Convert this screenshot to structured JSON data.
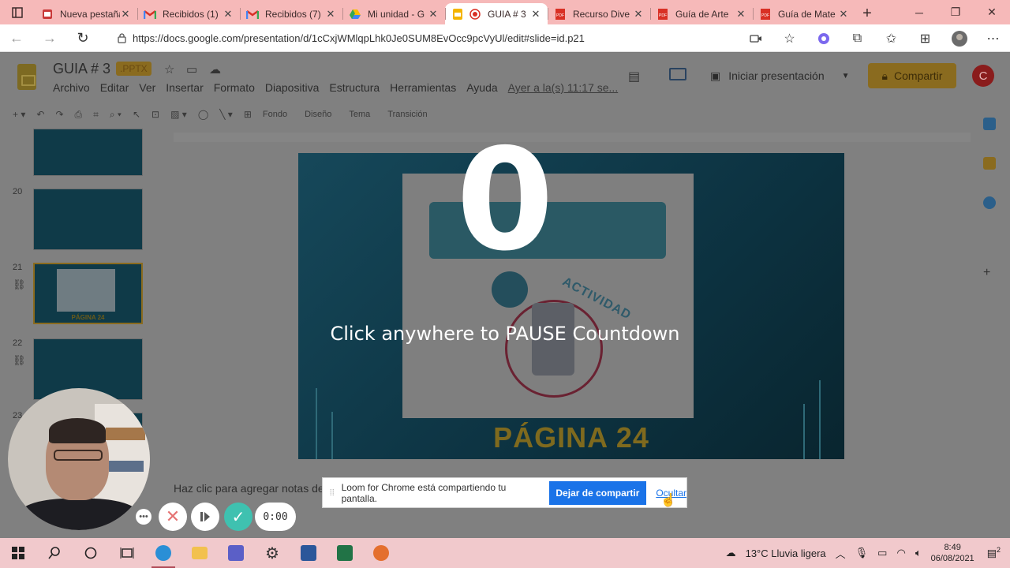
{
  "browser": {
    "tabs": [
      {
        "title": "Nueva pestaña",
        "icon": "newtab-icon",
        "active": false
      },
      {
        "title": "Recibidos (1)",
        "icon": "gmail-icon",
        "active": false
      },
      {
        "title": "Recibidos (7)",
        "icon": "gmail-icon",
        "active": false
      },
      {
        "title": "Mi unidad - G",
        "icon": "drive-icon",
        "active": false
      },
      {
        "title": "GUIA # 3",
        "icon": "slides-icon",
        "active": true
      },
      {
        "title": "Recurso Dive",
        "icon": "pdf-icon",
        "active": false
      },
      {
        "title": "Guía de Arte",
        "icon": "pdf-icon",
        "active": false
      },
      {
        "title": "Guía de Mate",
        "icon": "pdf-icon",
        "active": false
      }
    ],
    "url": "https://docs.google.com/presentation/d/1cCxjWMlqpLhk0Je0SUM8EvOcc9pcVyUl/edit#slide=id.p21"
  },
  "slides_app": {
    "doc_title": "GUIA # 3",
    "doc_badge": ".PPTX",
    "menu": [
      "Archivo",
      "Editar",
      "Ver",
      "Insertar",
      "Formato",
      "Diapositiva",
      "Estructura",
      "Herramientas",
      "Ayuda"
    ],
    "last_edit": "Ayer a la(s) 11:17 se...",
    "present_label": "Iniciar presentación",
    "share_label": "Compartir",
    "user_initial": "C",
    "toolbar_text": {
      "background": "Fondo",
      "layout": "Diseño",
      "theme": "Tema",
      "transition": "Transición"
    },
    "filmstrip": [
      {
        "num": "20"
      },
      {
        "num": "21",
        "caption": "PÁGINA 24",
        "selected": true
      },
      {
        "num": "22"
      },
      {
        "num": "23"
      }
    ],
    "slide_heading": "PÁGINA 24",
    "slide_side_text": "ACTIVIDAD",
    "notes_placeholder": "Haz clic para agregar notas de"
  },
  "countdown": {
    "number": "0",
    "message": "Click anywhere to PAUSE Countdown"
  },
  "loom": {
    "share_message": "Loom for Chrome está compartiendo tu pantalla.",
    "stop_label": "Dejar de compartir",
    "hide_label": "Ocultar",
    "timer": "0:00"
  },
  "taskbar": {
    "weather": "13°C  Lluvia ligera",
    "time": "8:49",
    "date": "06/08/2021",
    "notification_count": "2"
  },
  "colors": {
    "tabstrip": "#f6b9b9",
    "taskbar": "#f1c9cc",
    "loom_blue": "#1a73e8",
    "loom_teal": "#3fc1b0"
  }
}
